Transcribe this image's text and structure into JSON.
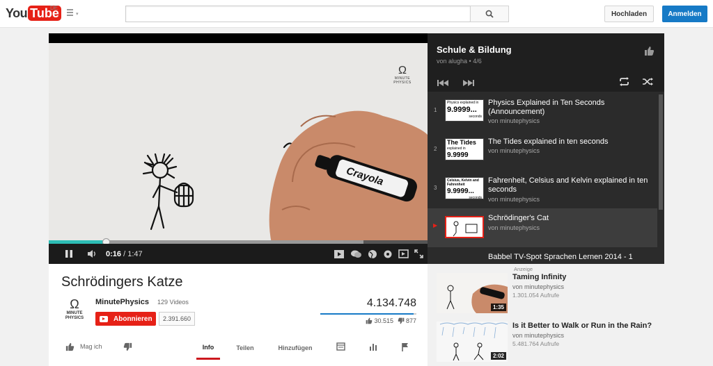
{
  "header": {
    "logo_you": "You",
    "logo_tube": "Tube",
    "region": "DE",
    "search_placeholder": "",
    "upload_label": "Hochladen",
    "signin_label": "Anmelden"
  },
  "player": {
    "current_time": "0:16",
    "separator": " / ",
    "duration": "1:47",
    "progress_fraction": 0.15,
    "buffered_fraction": 0.83,
    "brand_mark": "Ω",
    "brand_text": [
      "MINUTE",
      "PHYSICS"
    ],
    "marker_brand": "Crayola"
  },
  "playlist": {
    "title": "Schule & Bildung",
    "subtitle": "von alugha • 4/6",
    "items": [
      {
        "index": "1",
        "title": "Physics Explained in Ten Seconds (Announcement)",
        "channel": "von minutephysics",
        "thumb_top": "Physics explained in",
        "thumb_big": "9.9999...",
        "thumb_bottom": "seconds"
      },
      {
        "index": "2",
        "title": "The Tides explained in ten seconds",
        "channel": "von minutephysics",
        "thumb_top": "The Tides",
        "thumb_big": "9.9999",
        "thumb_bottom": "explained in"
      },
      {
        "index": "3",
        "title": "Fahrenheit, Celsius and Kelvin explained in ten seconds",
        "channel": "von minutephysics",
        "thumb_top": "Celsius, Kelvin and Fahrenheit",
        "thumb_big": "9.9999...",
        "thumb_bottom": "seconds"
      },
      {
        "index": "▶",
        "title": "Schrödinger's Cat",
        "channel": "von minutephysics",
        "active": true
      },
      {
        "index": "5",
        "title": "Babbel TV-Spot Sprachen Lernen 2014 - 1",
        "channel": ""
      }
    ]
  },
  "video": {
    "title": "Schrödingers Katze",
    "channel_name": "MinutePhysics",
    "channel_videos": "129 Videos",
    "avatar_mark": "Ω",
    "avatar_text": [
      "MINUTE",
      "PHYSICS"
    ],
    "subscribe_label": "Abonnieren",
    "subscriber_count": "2.391.660",
    "views": "4.134.748",
    "likes": "30.515",
    "dislikes": "877",
    "like_ratio": 0.97,
    "like_label": "Mag ich",
    "tabs": [
      "Info",
      "Teilen",
      "Hinzufügen"
    ]
  },
  "related": {
    "ad_label": "Anzeige",
    "items": [
      {
        "title": "Taming Infinity",
        "channel": "von minutephysics",
        "views": "1.301.054 Aufrufe",
        "duration": "1:35"
      },
      {
        "title": "Is it Better to Walk or Run in the Rain?",
        "channel": "von minutephysics",
        "views": "5.481.764 Aufrufe",
        "duration": "2:02"
      }
    ]
  },
  "colors": {
    "brand_red": "#e62117",
    "blue": "#167ac6",
    "progress": "#2dbdb5"
  }
}
